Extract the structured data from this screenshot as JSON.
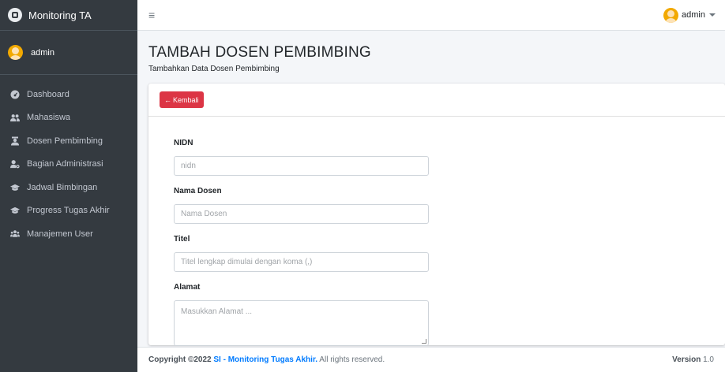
{
  "brand": {
    "title": "Monitoring TA"
  },
  "user": {
    "name": "admin"
  },
  "sidebar": {
    "items": [
      {
        "label": "Dashboard",
        "icon": "tachometer-icon"
      },
      {
        "label": "Mahasiswa",
        "icon": "users-icon"
      },
      {
        "label": "Dosen Pembimbing",
        "icon": "teacher-icon"
      },
      {
        "label": "Bagian Administrasi",
        "icon": "user-cog-icon"
      },
      {
        "label": "Jadwal Bimbingan",
        "icon": "graduation-cap-icon"
      },
      {
        "label": "Progress Tugas Akhir",
        "icon": "graduation-cap-icon"
      },
      {
        "label": "Manajemen User",
        "icon": "users-group-icon"
      }
    ]
  },
  "topbar": {
    "user_name": "admin"
  },
  "header": {
    "title": "TAMBAH DOSEN PEMBIMBING",
    "subtitle": "Tambahkan Data Dosen Pembimbing"
  },
  "card": {
    "back_label": "Kembali"
  },
  "form": {
    "nidn": {
      "label": "NIDN",
      "placeholder": "nidn"
    },
    "nama": {
      "label": "Nama Dosen",
      "placeholder": "Nama Dosen"
    },
    "titel": {
      "label": "Titel",
      "placeholder": "Titel lengkap dimulai dengan koma (,)"
    },
    "alamat": {
      "label": "Alamat",
      "placeholder": "Masukkan Alamat ..."
    }
  },
  "footer": {
    "copyright": "Copyright ©2022",
    "brand_link": "SI - Monitoring Tugas Akhir.",
    "rights": "All rights reserved.",
    "version_label": "Version",
    "version": "1.0"
  },
  "colors": {
    "sidebar_bg": "#343a40",
    "danger": "#dc3545",
    "link": "#007bff"
  }
}
